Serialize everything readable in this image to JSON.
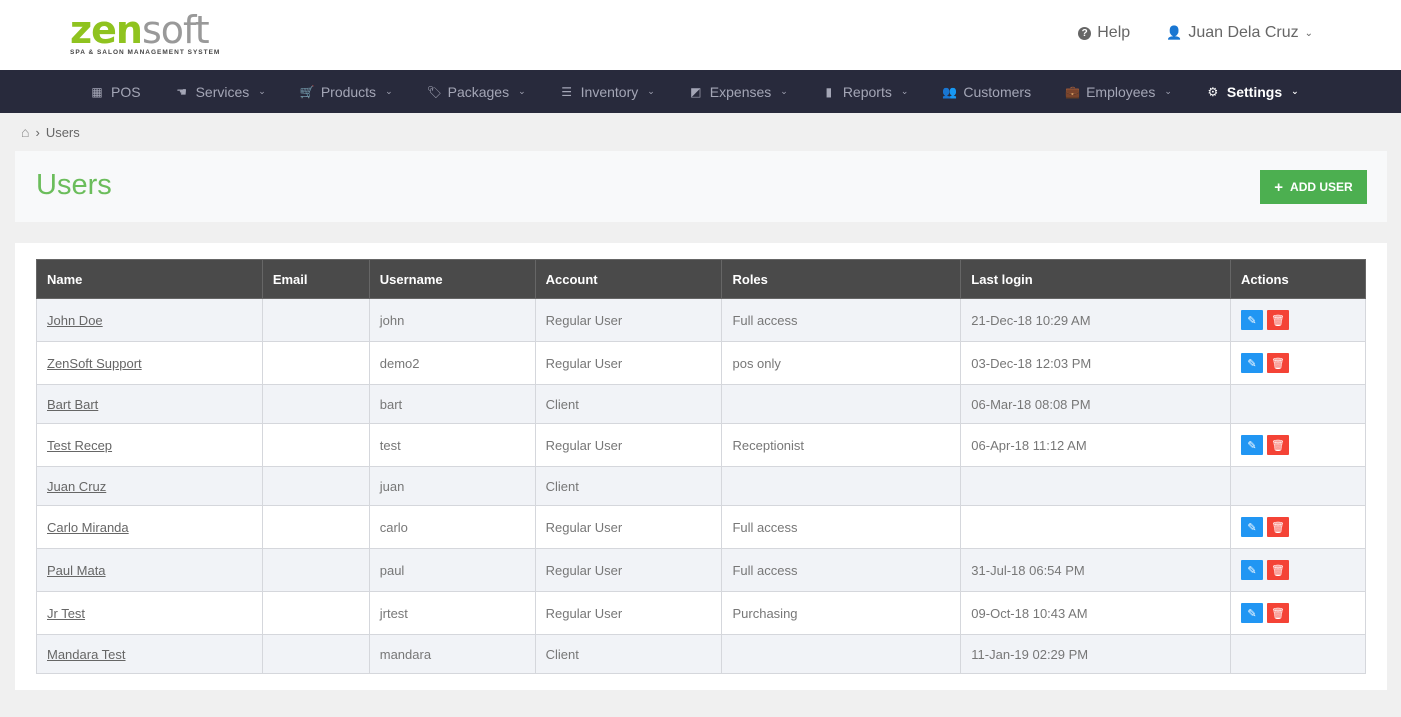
{
  "brand": {
    "logo_zen": "zen",
    "logo_soft": "soft",
    "tagline": "SPA & SALON MANAGEMENT SYSTEM"
  },
  "header": {
    "help_label": "Help",
    "user_name": "Juan Dela Cruz",
    "help_icon_glyph": "?",
    "user_icon_glyph": "👤",
    "caret_glyph": "⌄"
  },
  "nav": [
    {
      "label": "POS",
      "icon": "▦",
      "icon_name": "register-icon",
      "caret": ""
    },
    {
      "label": "Services",
      "icon": "☚",
      "icon_name": "hand-icon",
      "caret": "⌄"
    },
    {
      "label": "Products",
      "icon": "🛒",
      "icon_name": "cart-icon",
      "caret": "⌄"
    },
    {
      "label": "Packages",
      "icon": "🏷",
      "icon_name": "tags-icon",
      "caret": "⌄"
    },
    {
      "label": "Inventory",
      "icon": "☰",
      "icon_name": "list-icon",
      "caret": "⌄"
    },
    {
      "label": "Expenses",
      "icon": "◩",
      "icon_name": "money-icon",
      "caret": "⌄"
    },
    {
      "label": "Reports",
      "icon": "▮",
      "icon_name": "bar-chart-icon",
      "caret": "⌄"
    },
    {
      "label": "Customers",
      "icon": "👥",
      "icon_name": "users-icon",
      "caret": ""
    },
    {
      "label": "Employees",
      "icon": "💼",
      "icon_name": "briefcase-icon",
      "caret": "⌄"
    },
    {
      "label": "Settings",
      "icon": "⚙",
      "icon_name": "gear-icon",
      "caret": "⌄",
      "active": true
    }
  ],
  "breadcrumb": {
    "home_glyph": "⌂",
    "separator": "›",
    "current": "Users"
  },
  "page": {
    "title": "Users",
    "add_button_plus": "+",
    "add_button_label": "ADD USER"
  },
  "table": {
    "columns": [
      "Name",
      "Email",
      "Username",
      "Account",
      "Roles",
      "Last login",
      "Actions"
    ],
    "edit_glyph": "✎",
    "delete_glyph": "🗑",
    "rows": [
      {
        "name": "John Doe",
        "email": "",
        "username": "john",
        "account": "Regular User",
        "roles": "Full access",
        "last_login": "21-Dec-18 10:29 AM",
        "actions": true
      },
      {
        "name": "ZenSoft Support",
        "email": "",
        "username": "demo2",
        "account": "Regular User",
        "roles": "pos only",
        "last_login": "03-Dec-18 12:03 PM",
        "actions": true
      },
      {
        "name": "Bart Bart",
        "email": "",
        "username": "bart",
        "account": "Client",
        "roles": "",
        "last_login": "06-Mar-18 08:08 PM",
        "actions": false
      },
      {
        "name": "Test Recep",
        "email": "",
        "username": "test",
        "account": "Regular User",
        "roles": "Receptionist",
        "last_login": "06-Apr-18 11:12 AM",
        "actions": true
      },
      {
        "name": "Juan Cruz",
        "email": "",
        "username": "juan",
        "account": "Client",
        "roles": "",
        "last_login": "",
        "actions": false
      },
      {
        "name": "Carlo Miranda",
        "email": "",
        "username": "carlo",
        "account": "Regular User",
        "roles": "Full access",
        "last_login": "",
        "actions": true
      },
      {
        "name": "Paul Mata",
        "email": "",
        "username": "paul",
        "account": "Regular User",
        "roles": "Full access",
        "last_login": "31-Jul-18 06:54 PM",
        "actions": true
      },
      {
        "name": "Jr Test",
        "email": "",
        "username": "jrtest",
        "account": "Regular User",
        "roles": "Purchasing",
        "last_login": "09-Oct-18 10:43 AM",
        "actions": true
      },
      {
        "name": "Mandara Test",
        "email": "",
        "username": "mandara",
        "account": "Client",
        "roles": "",
        "last_login": "11-Jan-19 02:29 PM",
        "actions": false
      }
    ]
  },
  "colors": {
    "brand_green": "#8fc31f",
    "title_green": "#6bbd5b",
    "nav_bg": "#282a3c",
    "edit_blue": "#2196f3",
    "delete_red": "#f44336",
    "add_green": "#4caf50"
  }
}
